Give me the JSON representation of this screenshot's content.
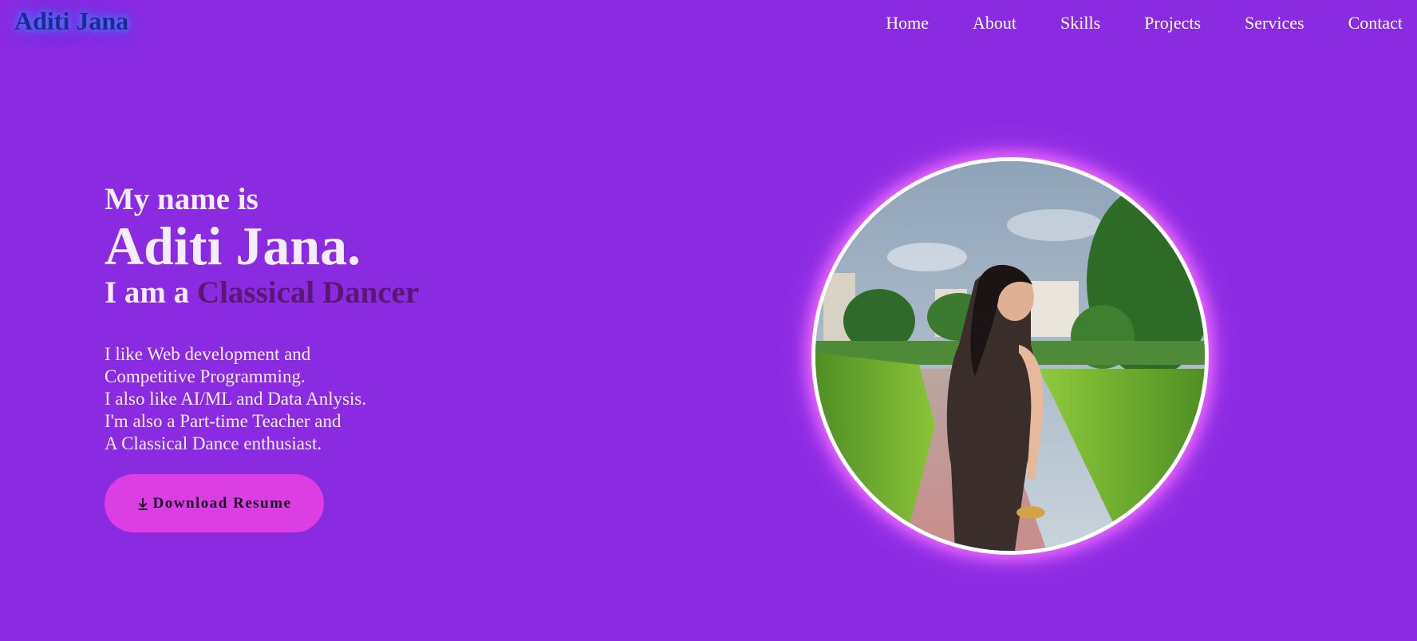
{
  "navbar": {
    "logo": "Aditi Jana",
    "links": [
      "Home",
      "About",
      "Skills",
      "Projects",
      "Services",
      "Contact"
    ]
  },
  "hero": {
    "greeting": "My name is",
    "name": "Aditi Jana.",
    "role_prefix": "I am a",
    "role": "Classical Dancer",
    "bio": [
      "I like Web development and",
      "Competitive Programming.",
      "I also like AI/ML and Data Anlysis.",
      "I'm also a Part-time Teacher and",
      "A Classical Dance enthusiast."
    ],
    "download_label": "Download Resume"
  },
  "colors": {
    "background": "#8a2be2",
    "logo": "#1c2a96",
    "role_highlight": "#5a1872",
    "button": "#db3ee3"
  },
  "icons": {
    "download": "download-arrow-icon"
  }
}
